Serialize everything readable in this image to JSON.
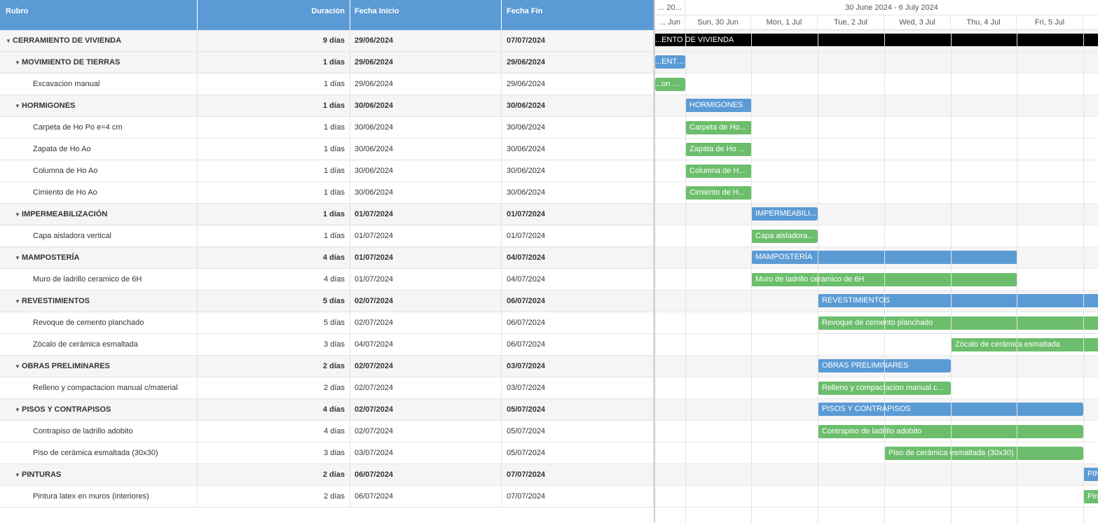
{
  "grid": {
    "headers": {
      "name": "Rubro",
      "duration": "Duración",
      "start": "Fecha Inicio",
      "end": "Fecha Fin"
    },
    "rows": [
      {
        "name": "CERRAMIENTO DE VIVIENDA",
        "duration": "9 días",
        "start": "29/06/2024",
        "end": "07/07/2024",
        "level": 0,
        "summary": true
      },
      {
        "name": "MOVIMIENTO DE TIERRAS",
        "duration": "1 días",
        "start": "29/06/2024",
        "end": "29/06/2024",
        "level": 1,
        "summary": true
      },
      {
        "name": "Excavacion manual",
        "duration": "1 días",
        "start": "29/06/2024",
        "end": "29/06/2024",
        "level": 2,
        "summary": false
      },
      {
        "name": "HORMIGONES",
        "duration": "1 días",
        "start": "30/06/2024",
        "end": "30/06/2024",
        "level": 1,
        "summary": true
      },
      {
        "name": "Carpeta de Ho Po e=4 cm",
        "duration": "1 días",
        "start": "30/06/2024",
        "end": "30/06/2024",
        "level": 2,
        "summary": false
      },
      {
        "name": "Zapata de Ho Ao",
        "duration": "1 días",
        "start": "30/06/2024",
        "end": "30/06/2024",
        "level": 2,
        "summary": false
      },
      {
        "name": "Columna de Ho Ao",
        "duration": "1 días",
        "start": "30/06/2024",
        "end": "30/06/2024",
        "level": 2,
        "summary": false
      },
      {
        "name": "Cimiento de Ho Ao",
        "duration": "1 días",
        "start": "30/06/2024",
        "end": "30/06/2024",
        "level": 2,
        "summary": false
      },
      {
        "name": "IMPERMEABILIZACIÓN",
        "duration": "1 días",
        "start": "01/07/2024",
        "end": "01/07/2024",
        "level": 1,
        "summary": true
      },
      {
        "name": "Capa aisladora vertical",
        "duration": "1 días",
        "start": "01/07/2024",
        "end": "01/07/2024",
        "level": 2,
        "summary": false
      },
      {
        "name": "MAMPOSTERÍA",
        "duration": "4 días",
        "start": "01/07/2024",
        "end": "04/07/2024",
        "level": 1,
        "summary": true
      },
      {
        "name": "Muro de ladrillo ceramico de 6H",
        "duration": "4 días",
        "start": "01/07/2024",
        "end": "04/07/2024",
        "level": 2,
        "summary": false
      },
      {
        "name": "REVESTIMIENTOS",
        "duration": "5 días",
        "start": "02/07/2024",
        "end": "06/07/2024",
        "level": 1,
        "summary": true
      },
      {
        "name": "Revoque de cemento planchado",
        "duration": "5 días",
        "start": "02/07/2024",
        "end": "06/07/2024",
        "level": 2,
        "summary": false
      },
      {
        "name": "Zócalo de cerámica esmaltada",
        "duration": "3 días",
        "start": "04/07/2024",
        "end": "06/07/2024",
        "level": 2,
        "summary": false
      },
      {
        "name": "OBRAS PRELIMINARES",
        "duration": "2 días",
        "start": "02/07/2024",
        "end": "03/07/2024",
        "level": 1,
        "summary": true
      },
      {
        "name": "Relleno y compactacion manual c/material",
        "duration": "2 días",
        "start": "02/07/2024",
        "end": "03/07/2024",
        "level": 2,
        "summary": false
      },
      {
        "name": "PISOS Y CONTRAPISOS",
        "duration": "4 días",
        "start": "02/07/2024",
        "end": "05/07/2024",
        "level": 1,
        "summary": true
      },
      {
        "name": "Contrapiso de ladrillo adobito",
        "duration": "4 días",
        "start": "02/07/2024",
        "end": "05/07/2024",
        "level": 2,
        "summary": false
      },
      {
        "name": "Piso de cerámica esmaltada (30x30)",
        "duration": "3 días",
        "start": "03/07/2024",
        "end": "05/07/2024",
        "level": 2,
        "summary": false
      },
      {
        "name": "PINTURAS",
        "duration": "2 días",
        "start": "06/07/2024",
        "end": "07/07/2024",
        "level": 1,
        "summary": true
      },
      {
        "name": "Pintura latex en muros (interiores)",
        "duration": "2 días",
        "start": "06/07/2024",
        "end": "07/07/2024",
        "level": 2,
        "summary": false
      }
    ]
  },
  "timeline": {
    "weeks": [
      "... 20...",
      "30 June 2024 - 6 July 2024"
    ],
    "days": [
      "... Jun",
      "Sun, 30 Jun",
      "Mon, 1 Jul",
      "Tue, 2 Jul",
      "Wed, 3 Jul",
      "Thu, 4 Jul",
      "Fri, 5 Jul"
    ],
    "bar_labels": [
      "...ENTO DE VIVIENDA",
      "...ENTO ...",
      "...on ma...",
      "HORMIGONES",
      "Carpeta de Ho...",
      "Zapata de Ho ...",
      "Columna de H...",
      "Cimiento de H...",
      "IMPERMEABILI...",
      "Capa aisladora...",
      "MAMPOSTERÍA",
      "Muro de ladrillo ceramico de 6H",
      "REVESTIMIENTOS",
      "Revoque de cemento planchado",
      "Zócalo de cerámica esmaltada",
      "OBRAS PRELIMINARES",
      "Relleno y compactacion manual c...",
      "PISOS Y CONTRAPISOS",
      "Contrapiso de ladrillo adobito",
      "Piso de cerámica esmaltada (30x30)",
      "PIN...",
      "Pin..."
    ]
  },
  "colors": {
    "header": "#5b9bd5",
    "task": "#6cbe6c",
    "summary_bar": "#5b9bd5",
    "project_bar": "#000000"
  }
}
